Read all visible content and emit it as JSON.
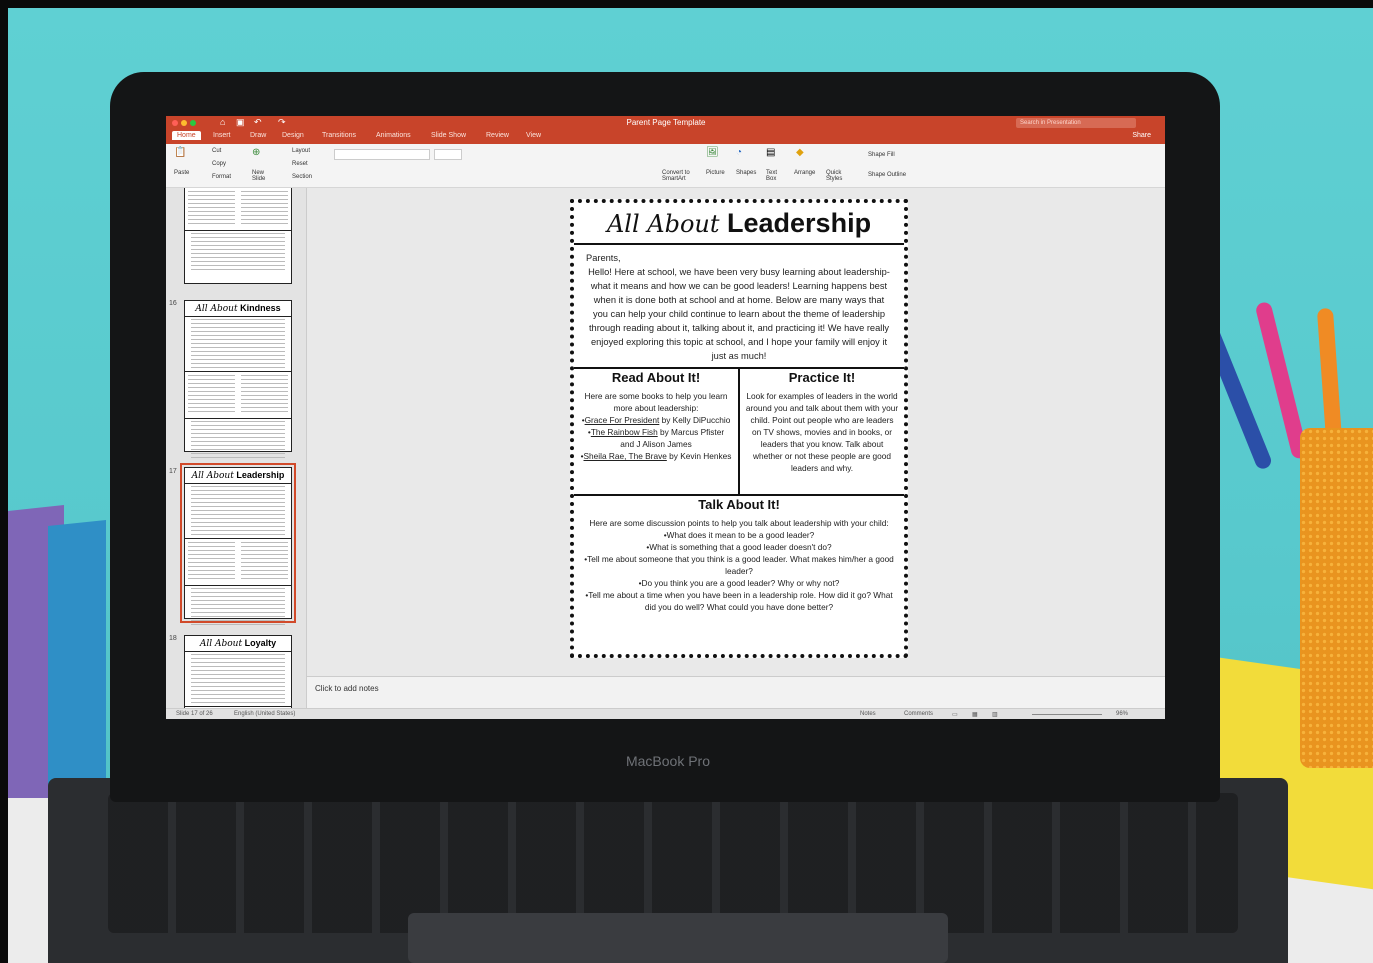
{
  "laptop": {
    "brand": "MacBook Pro"
  },
  "app": {
    "doc_title": "Parent Page Template",
    "search_placeholder": "Search in Presentation",
    "share_label": "Share"
  },
  "tabs": [
    "Home",
    "Insert",
    "Draw",
    "Design",
    "Transitions",
    "Animations",
    "Slide Show",
    "Review",
    "View"
  ],
  "ribbon": {
    "paste": "Paste",
    "cut": "Cut",
    "copy": "Copy",
    "format": "Format",
    "new_slide": "New Slide",
    "layout": "Layout",
    "reset": "Reset",
    "section": "Section",
    "convert_smartart": "Convert to SmartArt",
    "picture": "Picture",
    "shapes": "Shapes",
    "text_box": "Text Box",
    "arrange": "Arrange",
    "quick_styles": "Quick Styles",
    "shape_fill": "Shape Fill",
    "shape_outline": "Shape Outline"
  },
  "thumbnails": [
    {
      "num": "",
      "title": ""
    },
    {
      "num": "16",
      "title_script": "All About",
      "title_bold": "Kindness"
    },
    {
      "num": "17",
      "title_script": "All About",
      "title_bold": "Leadership"
    },
    {
      "num": "18",
      "title_script": "All About",
      "title_bold": "Loyalty"
    }
  ],
  "slide": {
    "title_script": "All About",
    "title_bold": "Leadership",
    "greeting": "Parents,",
    "intro": "Hello! Here at school, we have been very busy learning about leadership- what it means and how we can be good leaders! Learning happens best when it is done both at school and at home. Below are many ways that you can help your child continue to learn about the theme of leadership through reading about it, talking about it, and practicing it! We have really enjoyed exploring this topic at school, and I hope your family will enjoy it just as much!",
    "read": {
      "heading": "Read About It!",
      "intro": "Here are some books to help you learn more about leadership:",
      "book1_title": "Grace For President",
      "book1_by": " by Kelly DiPucchio",
      "book2_title": "The Rainbow Fish",
      "book2_by": " by Marcus Pfister",
      "book2_extra": "and J Alison James",
      "book3_title": "Sheila Rae, The Brave",
      "book3_by": " by Kevin Henkes"
    },
    "practice": {
      "heading": "Practice It!",
      "text": "Look for examples of leaders in the world around you and talk about them with your child. Point out people who are leaders on TV shows, movies and in books, or leaders that you know. Talk about whether or not these people are good leaders and why."
    },
    "talk": {
      "heading": "Talk About It!",
      "intro": "Here are some discussion points to help you talk about leadership with your child:",
      "points": [
        "•What does it mean to be a good leader?",
        "•What is something that a good leader doesn't do?",
        "•Tell me about someone that you think is a good leader. What makes him/her a good leader?",
        "•Do you think you are a good leader? Why or why not?",
        "•Tell me about a time when you have been in a leadership role. How did it go? What did you do well? What could you have done better?"
      ]
    }
  },
  "notes_placeholder": "Click to add notes",
  "status": {
    "slide_count": "Slide 17 of 26",
    "language": "English (United States)",
    "notes": "Notes",
    "comments": "Comments",
    "zoom": "96%"
  },
  "colors": {
    "accent": "#c8442a",
    "background": "#58c9cd"
  }
}
